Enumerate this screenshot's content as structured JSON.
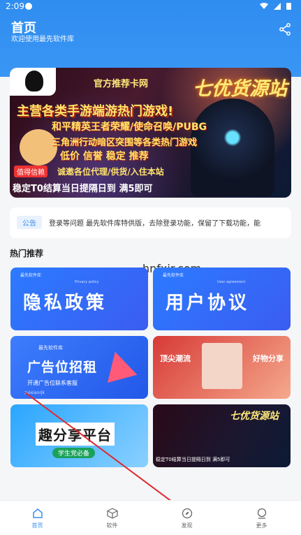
{
  "status": {
    "time": "2:09"
  },
  "header": {
    "title": "首页",
    "subtitle": "欢迎使用最先软件库"
  },
  "banner": {
    "line1": "官方推荐卡网",
    "line2": "七优货源站",
    "line3": "主营各类手游端游热门游戏!",
    "line4": "和平精英王者荣耀/使命召唤/PUBG",
    "line5": "三角洲行动暗区突围等各类热门游戏",
    "line6": "低价 信誉 稳定 推荐",
    "line7": "诚邀各位代理/供货/入住本站",
    "line8": "稳定T0结算当日提隔日到 满5即可",
    "badge": "值得信赖"
  },
  "notice": {
    "tag": "公告",
    "text": "登录等问题  最先软件库特供版，去除登录功能，保留了下载功能，能"
  },
  "section": {
    "title": "热门推荐",
    "watermark": "hnfxjr.com"
  },
  "cards": {
    "c1": {
      "brand": "最先软件库",
      "big": "隐私政策",
      "small": "Privacy policy"
    },
    "c2": {
      "brand": "最先软件库",
      "big": "用户协议",
      "small": "User agreement"
    },
    "c3": {
      "brand": "最先软件库",
      "big": "广告位招租",
      "sub": "开通广告位联系客服",
      "tiny": "zuixianrjk"
    },
    "c4": {
      "l": "顶尖潮流",
      "r": "好物分享"
    },
    "c5": {
      "big": "趣分享平台",
      "sub": "学生党必备"
    },
    "c6": {
      "t": "七优货源站",
      "t2": "稳定T0结算当日提隔日到 满5即可"
    }
  },
  "tabs": [
    {
      "label": "首页",
      "icon": "home-icon",
      "active": true
    },
    {
      "label": "软件",
      "icon": "box-icon",
      "active": false
    },
    {
      "label": "发现",
      "icon": "compass-icon",
      "active": false
    },
    {
      "label": "更多",
      "icon": "more-icon",
      "active": false
    }
  ],
  "colors": {
    "primary": "#3a8ef0",
    "arrow": "#e0282f"
  }
}
